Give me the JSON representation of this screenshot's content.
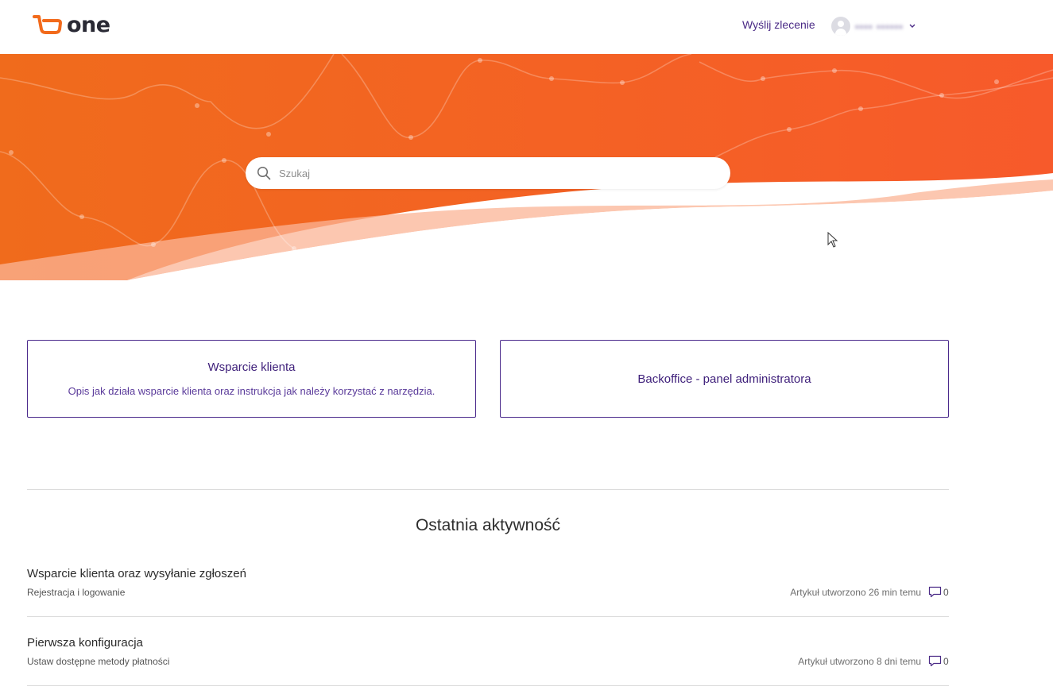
{
  "brand": {
    "logo_text": "one",
    "accent": "#f26a1b",
    "link_color": "#4a2a86"
  },
  "header": {
    "send_request_label": "Wyślij zlecenie",
    "user_name": "▪▪▪▪ ▪▪▪▪▪▪",
    "user_icon": "user-avatar-icon",
    "menu_icon": "chevron-down-icon"
  },
  "search": {
    "placeholder": "Szukaj",
    "value": "",
    "icon": "search-icon"
  },
  "cards": [
    {
      "title": "Wsparcie klienta",
      "description": "Opis jak działa wsparcie klienta oraz instrukcja jak należy korzystać z narzędzia."
    },
    {
      "title": "Backoffice - panel administratora"
    }
  ],
  "activity": {
    "title": "Ostatnia aktywność",
    "items": [
      {
        "title": "Wsparcie klienta oraz wysyłanie zgłoszeń",
        "section": "Rejestracja i logowanie",
        "meta": "Artykuł utworzono 26 min temu",
        "comments": "0"
      },
      {
        "title": "Pierwsza konfiguracja",
        "section": "Ustaw dostępne metody płatności",
        "meta": "Artykuł utworzono 8 dni temu",
        "comments": "0"
      }
    ]
  }
}
